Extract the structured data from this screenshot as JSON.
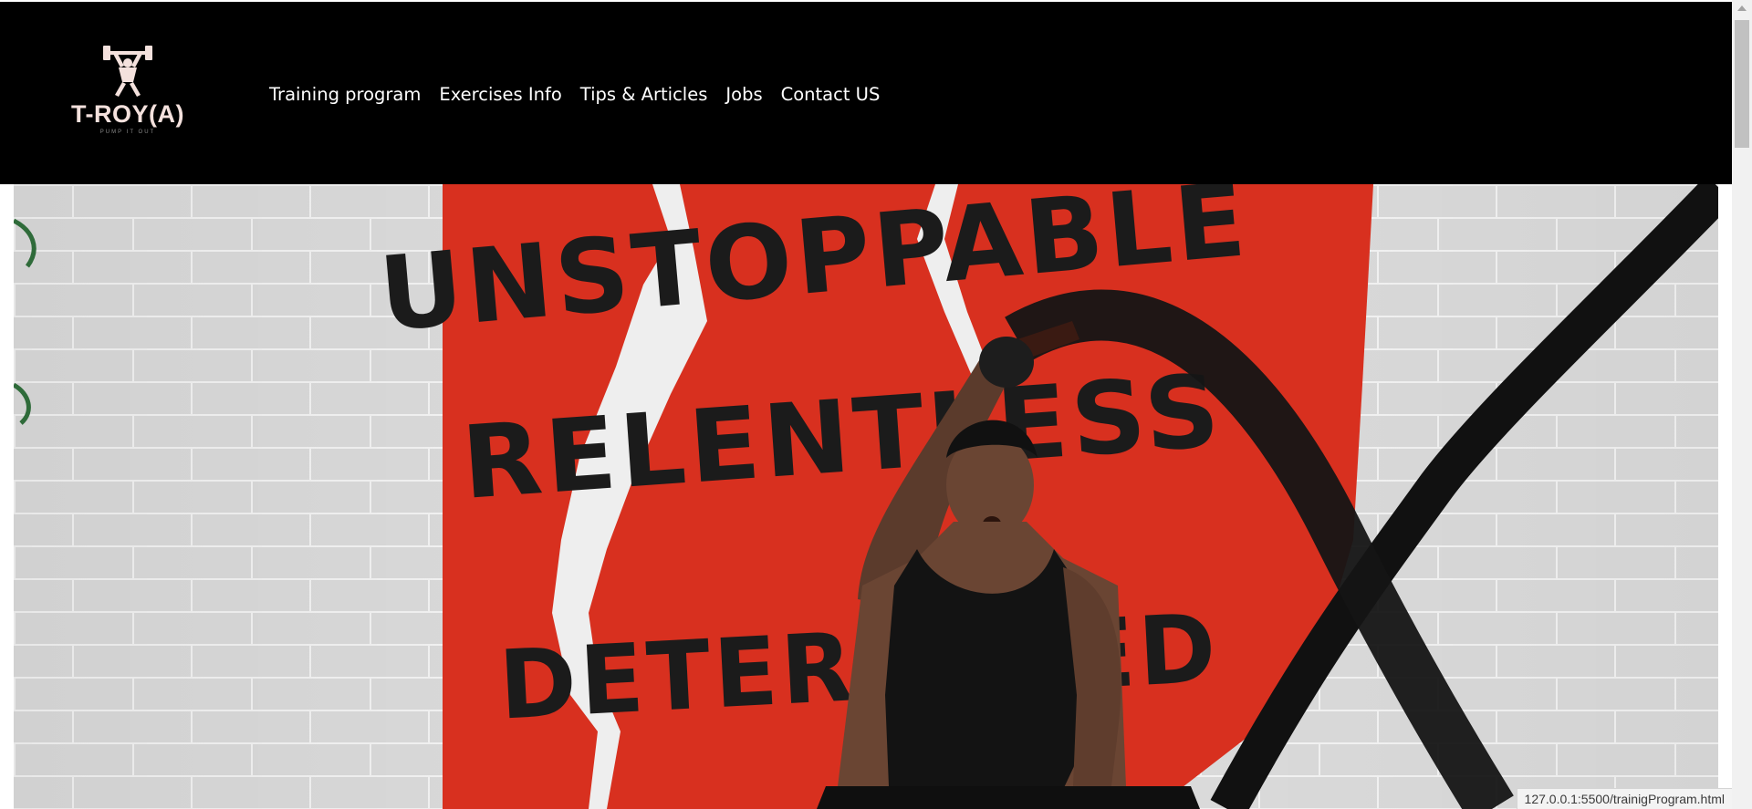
{
  "brand": {
    "name": "T-ROY(A)",
    "tagline": "PUMP IT OUT",
    "logo_icon": "weightlifter-icon",
    "accent_color": "#f4e1dd"
  },
  "nav": {
    "items": [
      {
        "label": "Training program"
      },
      {
        "label": "Exercises Info"
      },
      {
        "label": "Tips & Articles"
      },
      {
        "label": "Jobs"
      },
      {
        "label": "Contact US"
      }
    ]
  },
  "hero": {
    "mural_words": [
      "UNSTOPPABLE",
      "RELENTLESS",
      "DETERMINED"
    ],
    "mural_color": "#d8301f"
  },
  "status_bar": {
    "url": "127.0.0.1:5500/trainigProgram.html"
  }
}
